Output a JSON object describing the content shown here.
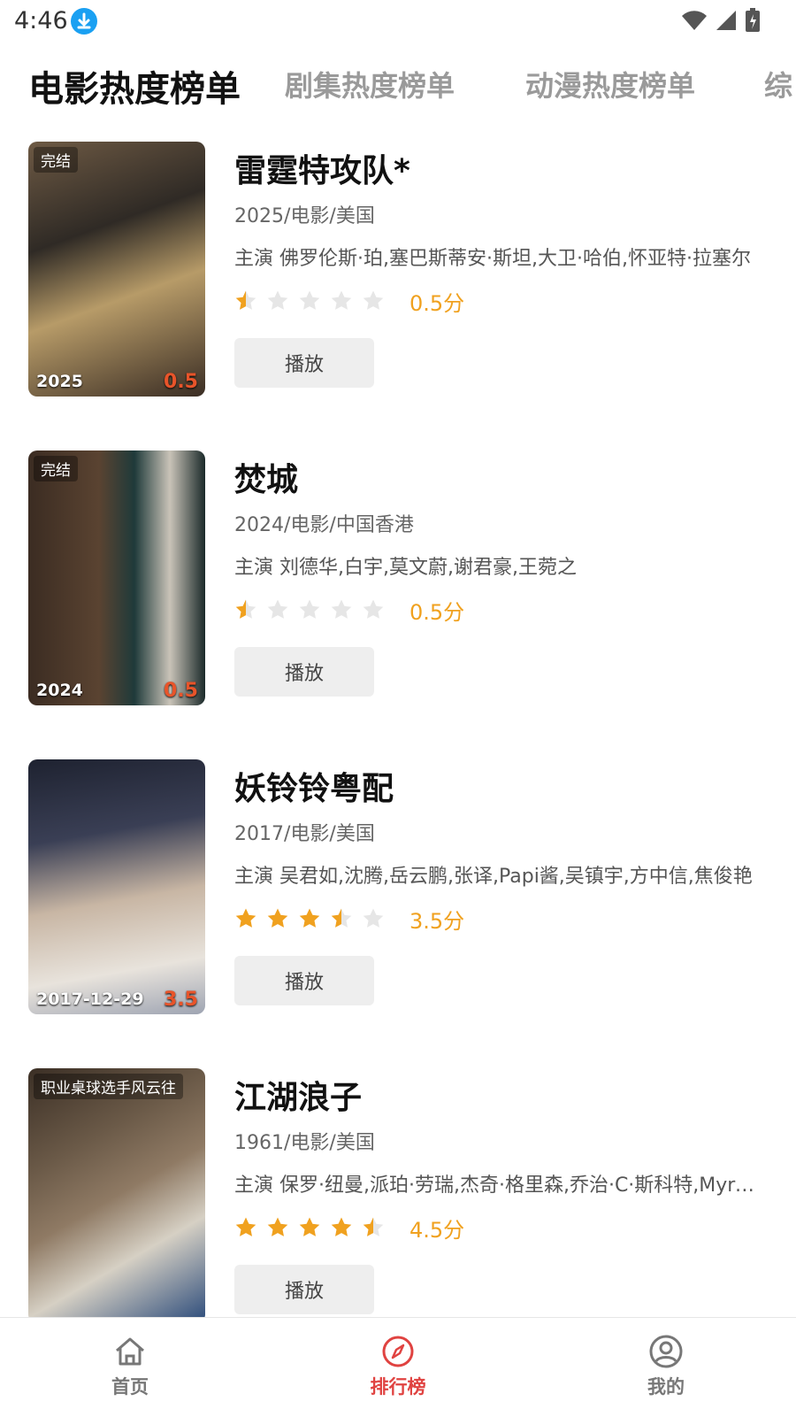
{
  "status_bar": {
    "time": "4:46"
  },
  "tabs": [
    {
      "label": "电影热度榜单",
      "active": true
    },
    {
      "label": "剧集热度榜单",
      "active": false
    },
    {
      "label": "动漫热度榜单",
      "active": false
    },
    {
      "label": "综",
      "active": false
    }
  ],
  "items": [
    {
      "title": "雷霆特攻队*",
      "meta": "2025/电影/美国",
      "cast": "主演 佛罗伦斯·珀,塞巴斯蒂安·斯坦,大卫·哈伯,怀亚特·拉塞尔",
      "rating": 0.5,
      "score_text": "0.5分",
      "play_label": "播放",
      "poster": {
        "tag": "完结",
        "year": "2025",
        "score": "0.5"
      }
    },
    {
      "title": "焚城",
      "meta": "2024/电影/中国香港",
      "cast": "主演 刘德华,白宇,莫文蔚,谢君豪,王菀之",
      "rating": 0.5,
      "score_text": "0.5分",
      "play_label": "播放",
      "poster": {
        "tag": "完结",
        "year": "2024",
        "score": "0.5"
      }
    },
    {
      "title": "妖铃铃粤配",
      "meta": "2017/电影/美国",
      "cast": "主演 吴君如,沈腾,岳云鹏,张译,Papi酱,吴镇宇,方中信,焦俊艳",
      "rating": 3.5,
      "score_text": "3.5分",
      "play_label": "播放",
      "poster": {
        "tag": "",
        "year": "2017-12-29",
        "score": "3.5"
      }
    },
    {
      "title": "江湖浪子",
      "meta": "1961/电影/美国",
      "cast": "主演 保罗·纽曼,派珀·劳瑞,杰奇·格里森,乔治·C·斯科特,Myron McCormick",
      "rating": 4.5,
      "score_text": "4.5分",
      "play_label": "播放",
      "poster": {
        "tag": "职业桌球选手风云往",
        "year": "",
        "score": ""
      }
    }
  ],
  "bottom_nav": [
    {
      "label": "首页",
      "icon": "home-icon",
      "active": false
    },
    {
      "label": "排行榜",
      "icon": "compass-icon",
      "active": true
    },
    {
      "label": "我的",
      "icon": "profile-icon",
      "active": false
    }
  ],
  "colors": {
    "accent": "#e04341",
    "star": "#f0a11f",
    "score_badge": "#e8542a"
  }
}
